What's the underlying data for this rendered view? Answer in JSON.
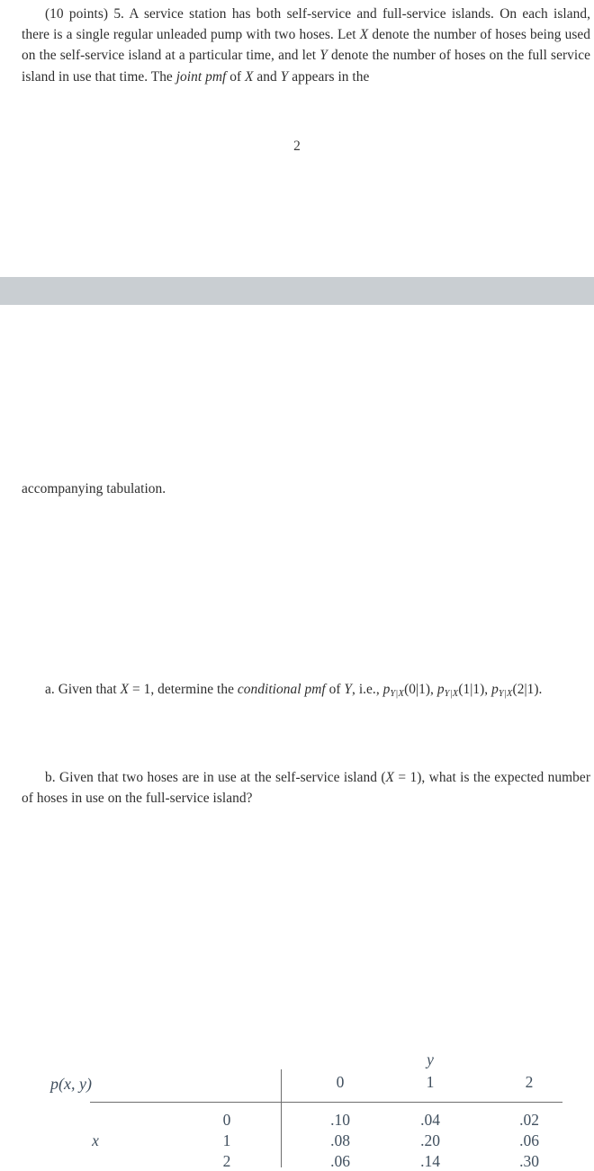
{
  "document": {
    "page_number": "2",
    "stem": {
      "points_label": "(10 points)",
      "problem_number": "5.",
      "text_part_1": "A service station has both self-service and full-service islands. On each island, there is a single regular unleaded pump with two hoses. Let ",
      "var_x": "X",
      "text_part_2": " denote the number of hoses being used on the self-service island at a particular time, and let ",
      "var_y": "Y",
      "text_part_3": " denote the number of hoses on the full service island in use that time. The ",
      "emphasis": "joint pmf",
      "text_part_4": " of ",
      "var_x2": "X",
      "text_part_5": " and ",
      "var_y2": "Y",
      "text_part_6": " appears in the"
    },
    "tabulation_line": "accompanying tabulation."
  },
  "table": {
    "corner_label": "p(x, y)",
    "column_group_label": "y",
    "row_group_label": "x",
    "column_headers": [
      "0",
      "1",
      "2"
    ],
    "row_headers": [
      "0",
      "1",
      "2"
    ],
    "values": [
      [
        ".10",
        ".04",
        ".02"
      ],
      [
        ".08",
        ".20",
        ".06"
      ],
      [
        ".06",
        ".14",
        ".30"
      ]
    ]
  },
  "questions": {
    "a": {
      "marker": "a.",
      "text_1": "Given that ",
      "cond_x": "X",
      "cond_eq": " = 1,",
      "text_2": " determine the ",
      "emphasis": "conditional pmf",
      "text_3": " of ",
      "var_y": "Y",
      "text_4": ", i.e., ",
      "term_1_p": "p",
      "term_1_sub": "Y|X",
      "term_1_args": "(0|1),",
      "term_2_p": "p",
      "term_2_sub": "Y|X",
      "term_2_args": "(1|1),",
      "term_3_p": "p",
      "term_3_sub": "Y|X",
      "term_3_args": "(2|1)."
    },
    "b": {
      "marker": "b.",
      "text_1": "Given that two hoses are in use at the self-service island (",
      "var_x": "X",
      "text_2": " = 1),",
      "text_3": " what is the expected number of hoses in use on the full-service island?"
    }
  },
  "colors": {
    "band": "#c9ced2",
    "body_text": "#2e2e2e",
    "table_text": "#41505f",
    "rule": "#6e6e6e"
  },
  "chart_data": {
    "type": "table",
    "title": "Joint pmf of X and Y",
    "xlabel": "x",
    "ylabel": "y",
    "categories": [
      "0",
      "1",
      "2"
    ],
    "series": [
      {
        "name": "x = 0",
        "values": [
          0.1,
          0.04,
          0.02
        ]
      },
      {
        "name": "x = 1",
        "values": [
          0.08,
          0.2,
          0.06
        ]
      },
      {
        "name": "x = 2",
        "values": [
          0.06,
          0.14,
          0.3
        ]
      }
    ]
  }
}
